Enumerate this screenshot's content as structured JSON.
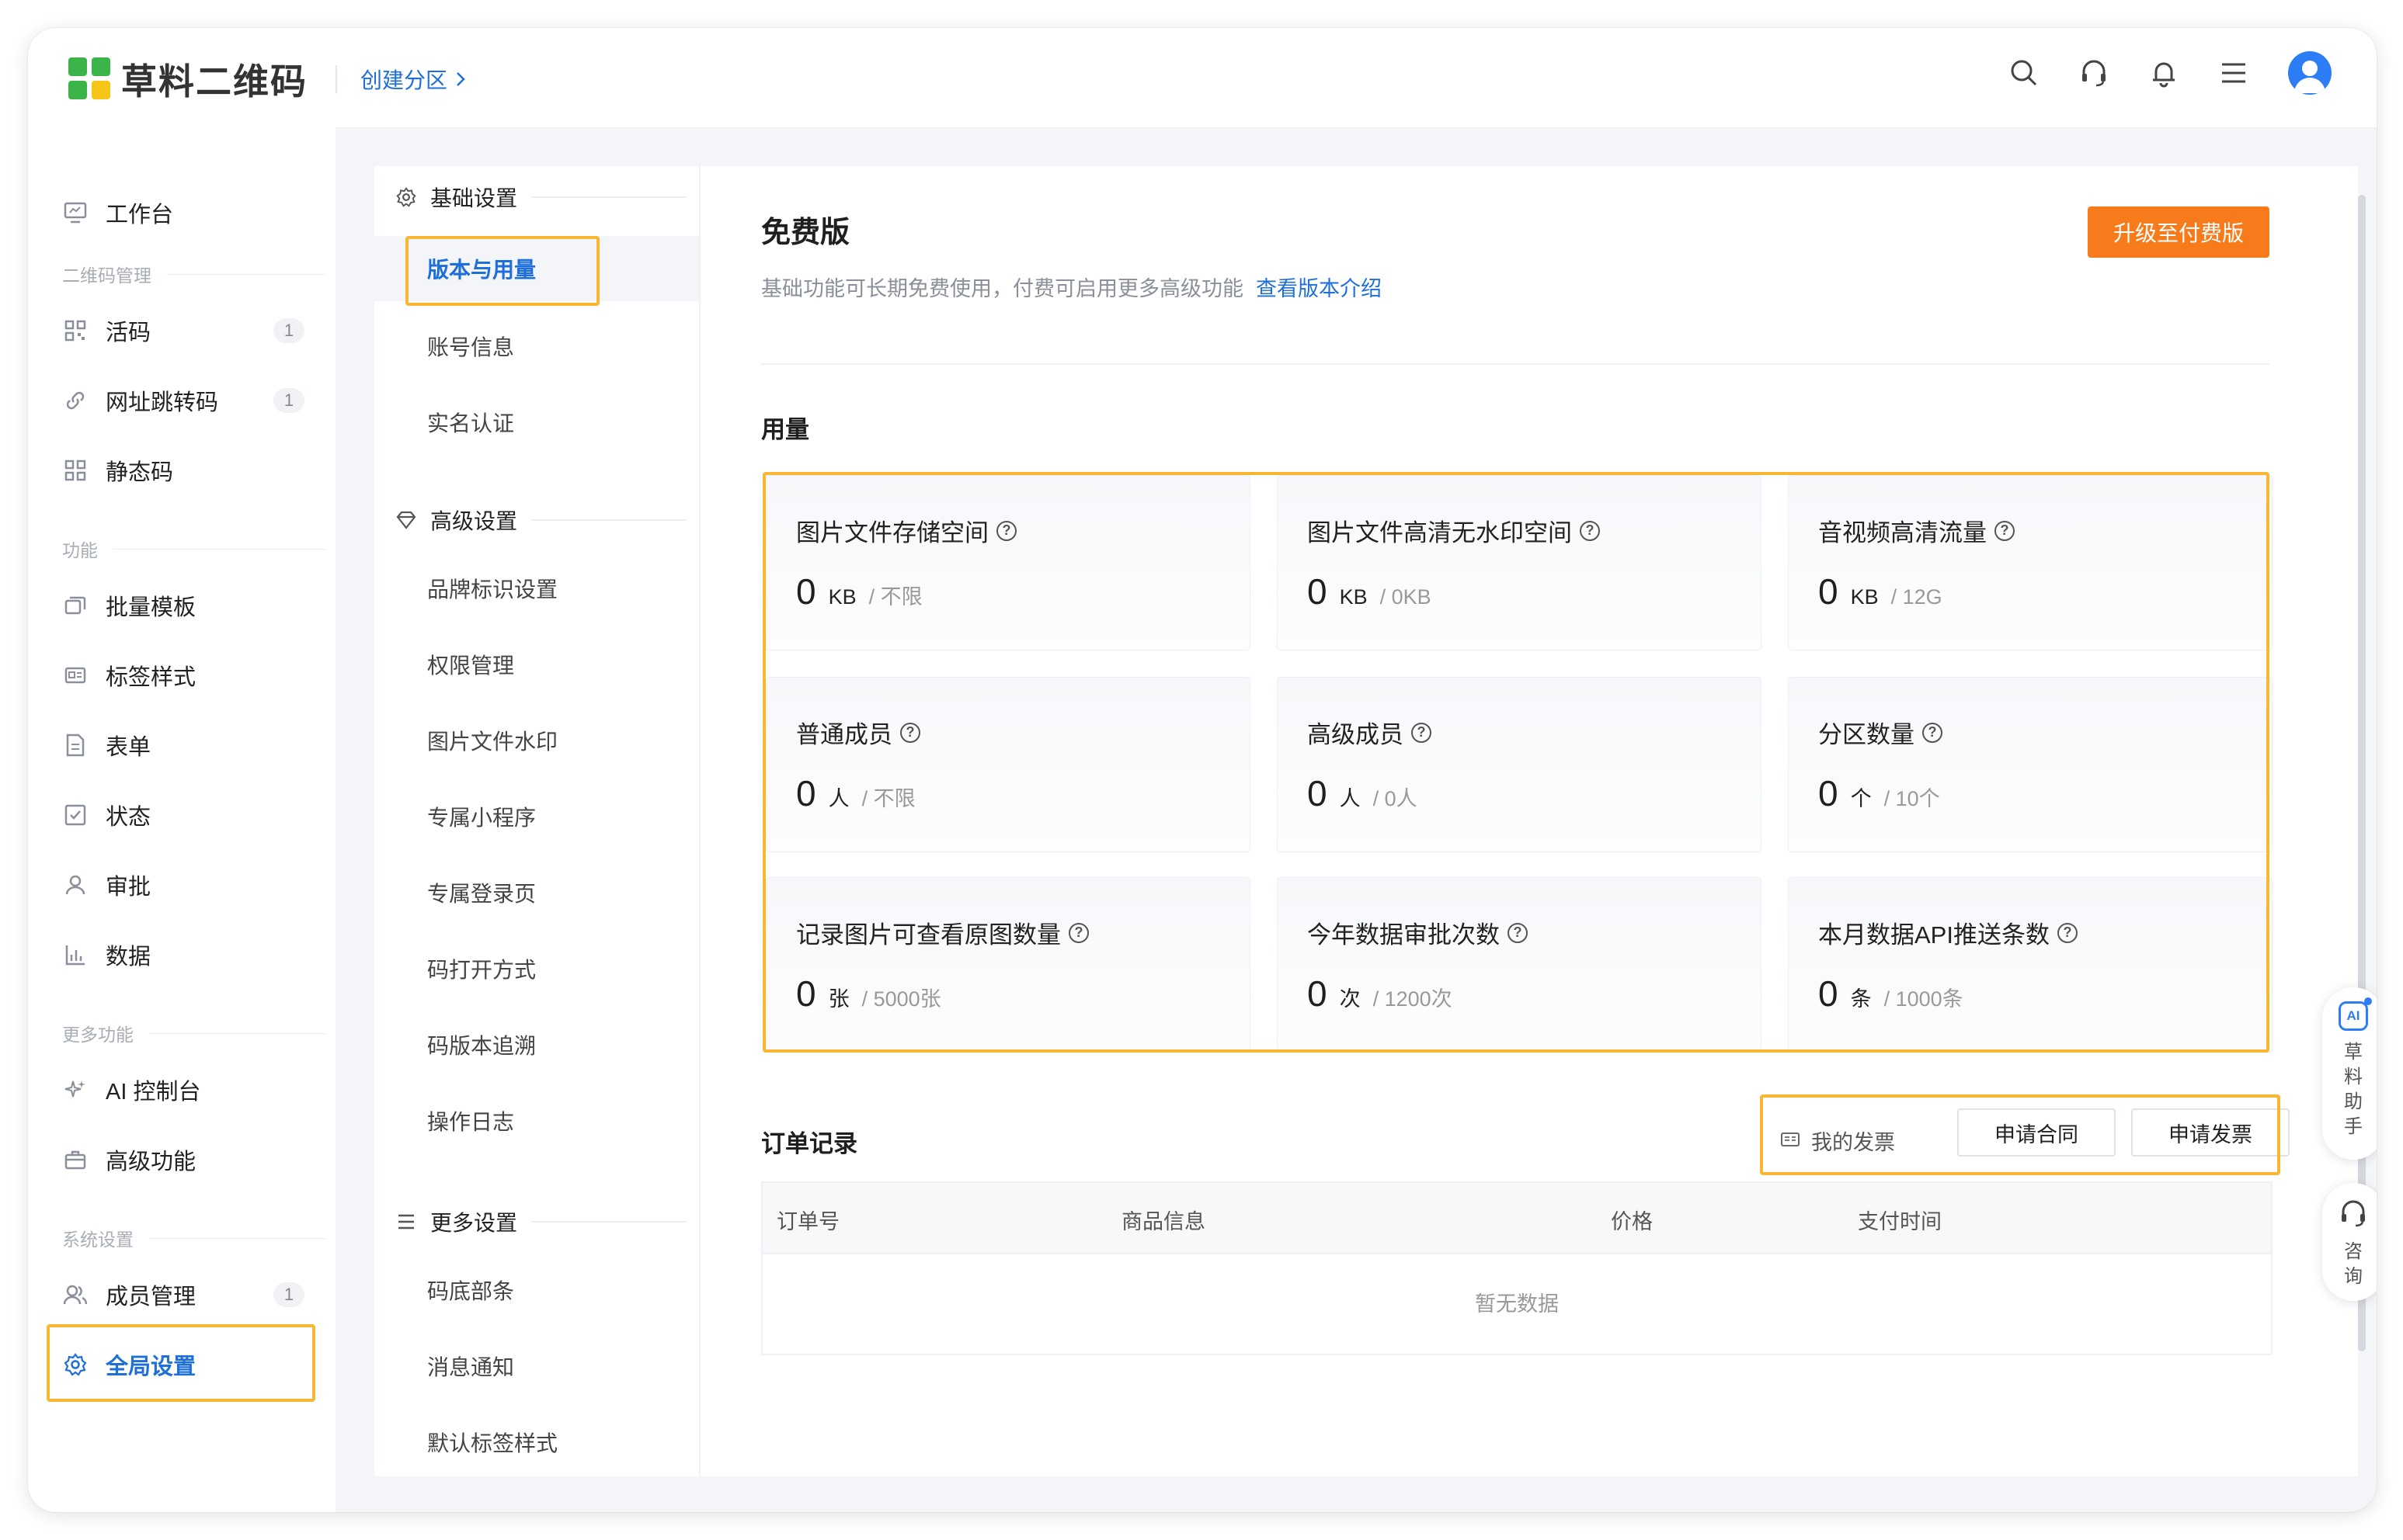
{
  "header": {
    "brand": "草料二维码",
    "create_link": "创建分区",
    "icons": [
      "search-icon",
      "headset-icon",
      "bell-icon",
      "menu-icon",
      "avatar"
    ]
  },
  "sidebar": {
    "workbench": "工作台",
    "group_qr": "二维码管理",
    "live_code": "活码",
    "live_code_count": "1",
    "url_redirect": "网址跳转码",
    "url_redirect_count": "1",
    "static_code": "静态码",
    "group_function": "功能",
    "batch_template": "批量模板",
    "label_style": "标签样式",
    "form": "表单",
    "status": "状态",
    "approval": "审批",
    "data": "数据",
    "group_more": "更多功能",
    "ai_console": "AI 控制台",
    "advanced": "高级功能",
    "group_system": "系统设置",
    "members": "成员管理",
    "members_count": "1",
    "global_settings": "全局设置"
  },
  "settings_nav": {
    "basic_group": "基础设置",
    "version_usage": "版本与用量",
    "account_info": "账号信息",
    "real_name": "实名认证",
    "advanced_group": "高级设置",
    "brand_logo": "品牌标识设置",
    "permissions": "权限管理",
    "image_watermark": "图片文件水印",
    "mini_program": "专属小程序",
    "login_page": "专属登录页",
    "open_method": "码打开方式",
    "version_trace": "码版本追溯",
    "operation_log": "操作日志",
    "more_group": "更多设置",
    "code_bottom": "码底部条",
    "notification": "消息通知",
    "default_label": "默认标签样式"
  },
  "plan": {
    "title": "免费版",
    "description": "基础功能可长期免费使用，付费可启用更多高级功能",
    "intro_link": "查看版本介绍",
    "upgrade_button": "升级至付费版"
  },
  "usage": {
    "title": "用量",
    "cards": [
      {
        "label": "图片文件存储空间",
        "value": "0",
        "unit": "KB",
        "limit": "/ 不限"
      },
      {
        "label": "图片文件高清无水印空间",
        "value": "0",
        "unit": "KB",
        "limit": "/ 0KB"
      },
      {
        "label": "音视频高清流量",
        "value": "0",
        "unit": "KB",
        "limit": "/ 12G"
      },
      {
        "label": "普通成员",
        "value": "0",
        "unit": "人",
        "limit": "/ 不限"
      },
      {
        "label": "高级成员",
        "value": "0",
        "unit": "人",
        "limit": "/ 0人"
      },
      {
        "label": "分区数量",
        "value": "0",
        "unit": "个",
        "limit": "/ 10个"
      },
      {
        "label": "记录图片可查看原图数量",
        "value": "0",
        "unit": "张",
        "limit": "/ 5000张"
      },
      {
        "label": "今年数据审批次数",
        "value": "0",
        "unit": "次",
        "limit": "/ 1200次"
      },
      {
        "label": "本月数据API推送条数",
        "value": "0",
        "unit": "条",
        "limit": "/ 1000条"
      }
    ]
  },
  "orders": {
    "title": "订单记录",
    "my_invoice": "我的发票",
    "apply_contract": "申请合同",
    "apply_invoice": "申请发票",
    "columns": [
      "订单号",
      "商品信息",
      "价格",
      "支付时间"
    ],
    "empty": "暂无数据"
  },
  "floating": {
    "ai_badge": "AI",
    "assistant": "草料助手",
    "consult": "咨询"
  },
  "colors": {
    "accent": "#1e6fd9",
    "upgrade": "#f77b1a",
    "highlight": "#f7b733",
    "logo_green": "#3bb54a",
    "logo_yellow": "#f5c518"
  }
}
